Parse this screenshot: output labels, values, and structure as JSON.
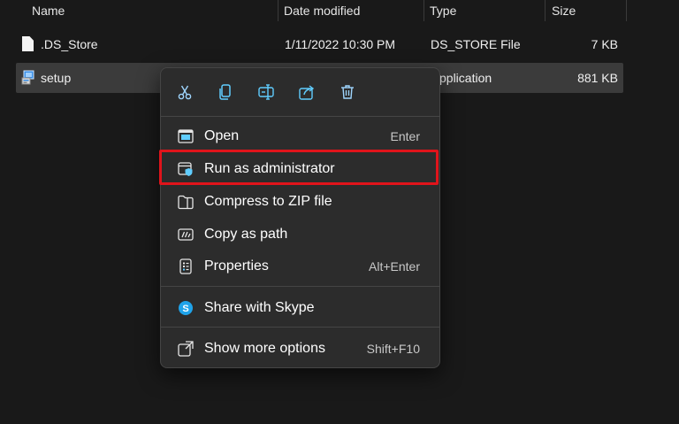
{
  "columns": {
    "name": "Name",
    "date": "Date modified",
    "type": "Type",
    "size": "Size"
  },
  "files": [
    {
      "name": ".DS_Store",
      "date": "1/11/2022 10:30 PM",
      "type": "DS_STORE File",
      "size": "7 KB",
      "icon": "file-icon"
    },
    {
      "name": "setup",
      "date": "",
      "type": "Application",
      "type_visible": "pplication",
      "size": "881 KB",
      "icon": "setup-icon"
    }
  ],
  "quick_actions": [
    {
      "name": "cut",
      "icon": "scissors-icon"
    },
    {
      "name": "copy",
      "icon": "copy-icon"
    },
    {
      "name": "rename",
      "icon": "rename-icon"
    },
    {
      "name": "share",
      "icon": "share-icon"
    },
    {
      "name": "delete",
      "icon": "trash-icon"
    }
  ],
  "menu": {
    "open": {
      "label": "Open",
      "shortcut": "Enter"
    },
    "run_admin": {
      "label": "Run as administrator"
    },
    "compress": {
      "label": "Compress to ZIP file"
    },
    "copy_path": {
      "label": "Copy as path"
    },
    "properties": {
      "label": "Properties",
      "shortcut": "Alt+Enter"
    },
    "skype": {
      "label": "Share with Skype"
    },
    "more": {
      "label": "Show more options",
      "shortcut": "Shift+F10"
    }
  },
  "colors": {
    "accent": "#60cdff",
    "highlight": "#e0141b",
    "menu_bg": "#2c2c2c",
    "window_bg": "#191919"
  }
}
